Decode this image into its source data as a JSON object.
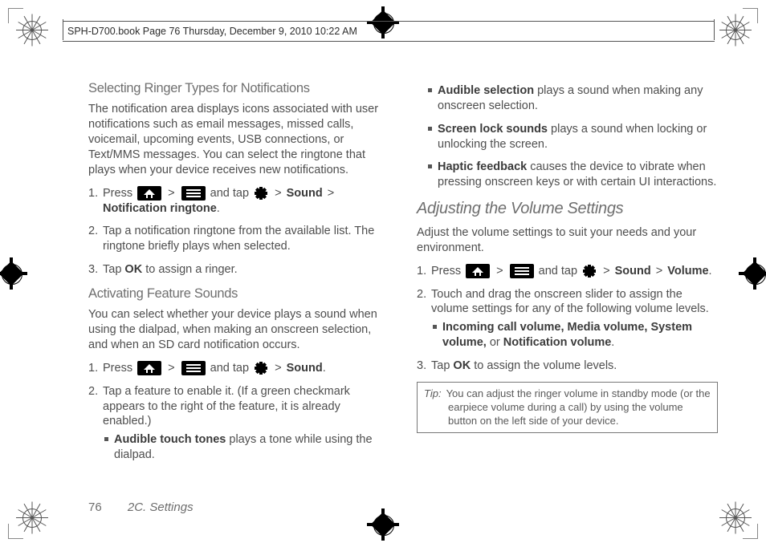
{
  "header": "SPH-D700.book  Page 76  Thursday, December 9, 2010  10:22 AM",
  "footer": {
    "page": "76",
    "section": "2C. Settings"
  },
  "col1": {
    "h1": "Selecting Ringer Types for Notifications",
    "p1": "The notification area displays icons associated with user notifications such as email messages, missed calls, voicemail, upcoming events, USB connections, or Text/MMS messages. You can select the ringtone that plays when your device receives new notifications.",
    "s1_a": "Press ",
    "s1_b": " and tap ",
    "s1_sound": "Sound",
    "s1_nr": "Notification ringtone",
    "s2": "Tap a notification ringtone from the available list. The ringtone briefly plays when selected.",
    "s3_a": "Tap ",
    "s3_ok": "OK",
    "s3_b": " to assign a ringer.",
    "h2": "Activating Feature Sounds",
    "p2": "You can select whether your device plays a sound when using the dialpad, when making an onscreen selection, and when an SD card notification occurs.",
    "s4_a": "Press ",
    "s4_b": " and tap ",
    "s4_sound": "Sound",
    "s5": "Tap a feature to enable it. (If a green checkmark appears to the right of the feature, it is already enabled.)",
    "b1_t": "Audible touch tones",
    "b1_r": " plays a tone while using the dialpad."
  },
  "col2": {
    "b2_t": "Audible selection",
    "b2_r": " plays a sound when making any onscreen selection.",
    "b3_t": "Screen lock sounds",
    "b3_r": " plays a sound when locking or unlocking the screen.",
    "b4_t": "Haptic feedback",
    "b4_r": " causes the device to vibrate when pressing onscreen keys or with certain UI interactions.",
    "h3": "Adjusting the Volume Settings",
    "p3": "Adjust the volume settings to suit your needs and your environment.",
    "s6_a": "Press ",
    "s6_b": " and tap ",
    "s6_sound": "Sound",
    "s6_vol": "Volume",
    "s7": "Touch and drag the onscreen slider to assign the volume settings for any of the following volume levels.",
    "b5_t": "Incoming call volume, Media volume, System volume,",
    "b5_or": " or ",
    "b5_t2": "Notification volume",
    "s8_a": "Tap ",
    "s8_ok": "OK",
    "s8_b": " to assign the volume levels.",
    "tip_label": "Tip:",
    "tip_text": "You can adjust the ringer volume in standby mode (or the earpiece volume during a call) by using the volume button on the left side of your device."
  },
  "gt": ">"
}
